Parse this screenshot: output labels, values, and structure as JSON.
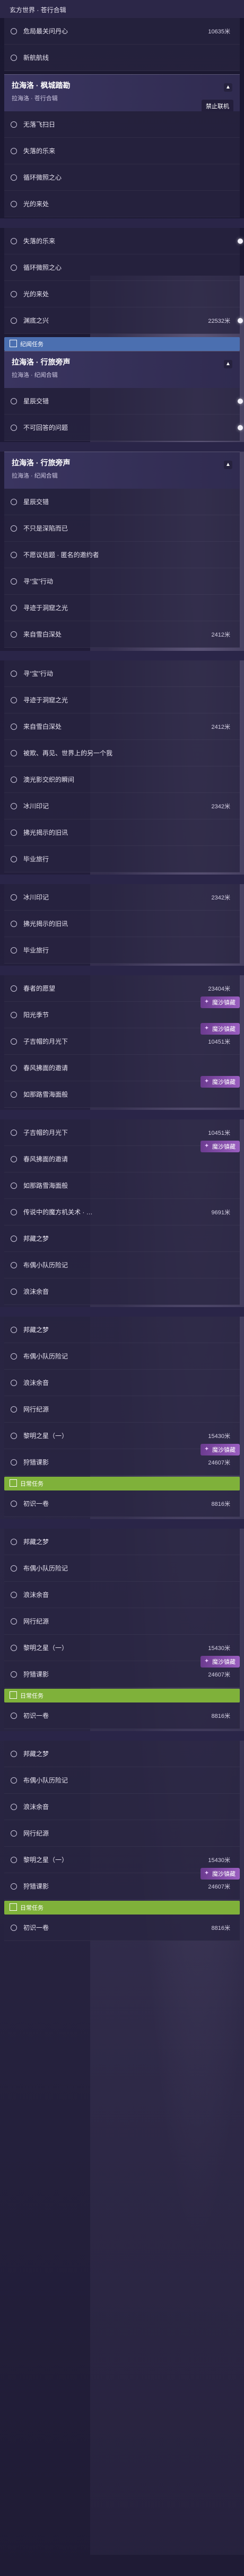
{
  "topbar": {
    "crumb": "玄方世界 · 苍行合辑"
  },
  "watermark": "禁止联机",
  "headers": {
    "fontaine_city": {
      "title": "拉海洛 · 枫城踏勘",
      "sub": "拉海洛 · 苍行合辑"
    },
    "journey": {
      "title": "拉海洛 · 行旅旁声",
      "sub": "拉海洛 · 纪闻合辑"
    }
  },
  "tags": {
    "commission": "纪闻任务",
    "daily": "日常任务"
  },
  "badge_text": "魔沙镇藏",
  "rows": [
    {
      "label": "危局最关问丹心",
      "dist": "10635米"
    },
    {
      "label": "新航航线",
      "dist": ""
    },
    {
      "label": "无落飞扫日",
      "dist": ""
    },
    {
      "label": "失落的乐来",
      "dist": ""
    },
    {
      "label": "循环微照之心",
      "dist": ""
    },
    {
      "label": "光的来处",
      "dist": ""
    },
    {
      "label": "失落的乐来",
      "dist": ""
    },
    {
      "label": "循环微照之心",
      "dist": ""
    },
    {
      "label": "光的来处",
      "dist": ""
    },
    {
      "label": "渊底之兴",
      "dist": "22532米"
    },
    {
      "label": "星辰交错",
      "dist": ""
    },
    {
      "label": "不可回答的问题",
      "dist": ""
    },
    {
      "label": "星辰交错",
      "dist": ""
    },
    {
      "label": "不只是深陷而已",
      "dist": ""
    },
    {
      "label": "不愿议信题 · 匿名的邀约者",
      "dist": ""
    },
    {
      "label": "寻“宝”行动",
      "dist": ""
    },
    {
      "label": "寻迹于洞窟之光",
      "dist": ""
    },
    {
      "label": "来自雪白深处",
      "dist": "2412米"
    },
    {
      "label": "寻“宝”行动",
      "dist": ""
    },
    {
      "label": "寻迹于洞窟之光",
      "dist": ""
    },
    {
      "label": "来自雪白深处",
      "dist": "2412米"
    },
    {
      "label": "被欺、再见、世界上的另一个我",
      "dist": ""
    },
    {
      "label": "澳光影交织的瞬间",
      "dist": ""
    },
    {
      "label": "冰川印记",
      "dist": "2342米"
    },
    {
      "label": "拂光揭示的旧讯",
      "dist": ""
    },
    {
      "label": "毕业旅行",
      "dist": ""
    },
    {
      "label": "冰川印记",
      "dist": "2342米"
    },
    {
      "label": "拂光揭示的旧讯",
      "dist": ""
    },
    {
      "label": "毕业旅行",
      "dist": ""
    },
    {
      "label": "春者的愿望",
      "dist": "23404米"
    },
    {
      "label": "阳光季节",
      "dist": ""
    },
    {
      "label": "子吉帽的月光下",
      "dist": "10451米"
    },
    {
      "label": "春风拂面的邀请",
      "dist": ""
    },
    {
      "label": "如那路雪海面般",
      "dist": ""
    },
    {
      "label": "子吉帽的月光下",
      "dist": "10451米"
    },
    {
      "label": "春风拂面的邀请",
      "dist": ""
    },
    {
      "label": "如那路雪海面般",
      "dist": ""
    },
    {
      "label": "传说中的魔方机关术 · …",
      "dist": "9691米"
    },
    {
      "label": "邦藏之梦",
      "dist": ""
    },
    {
      "label": "布偶小队历险记",
      "dist": ""
    },
    {
      "label": "浪沫余音",
      "dist": ""
    },
    {
      "label": "邦藏之梦",
      "dist": ""
    },
    {
      "label": "布偶小队历险记",
      "dist": ""
    },
    {
      "label": "浪沫余音",
      "dist": ""
    },
    {
      "label": "网行纪源",
      "dist": ""
    },
    {
      "label": "黎明之星（一）",
      "dist": "15430米"
    },
    {
      "label": "狩猎课影",
      "dist": "24607米"
    },
    {
      "label": "初识一卷",
      "dist": "8816米"
    },
    {
      "label": "邦藏之梦",
      "dist": ""
    },
    {
      "label": "布偶小队历险记",
      "dist": ""
    },
    {
      "label": "浪沫余音",
      "dist": ""
    },
    {
      "label": "网行纪源",
      "dist": ""
    },
    {
      "label": "黎明之星（一）",
      "dist": "15430米"
    },
    {
      "label": "狩猎课影",
      "dist": "24607米"
    },
    {
      "label": "初识一卷",
      "dist": "8816米"
    },
    {
      "label": "邦藏之梦",
      "dist": ""
    },
    {
      "label": "布偶小队历险记",
      "dist": ""
    },
    {
      "label": "浪沫余音",
      "dist": ""
    },
    {
      "label": "网行纪源",
      "dist": ""
    },
    {
      "label": "黎明之星（一）",
      "dist": "15430米"
    },
    {
      "label": "狩猎课影",
      "dist": "24607米"
    },
    {
      "label": "初识一卷",
      "dist": "8816米"
    }
  ]
}
